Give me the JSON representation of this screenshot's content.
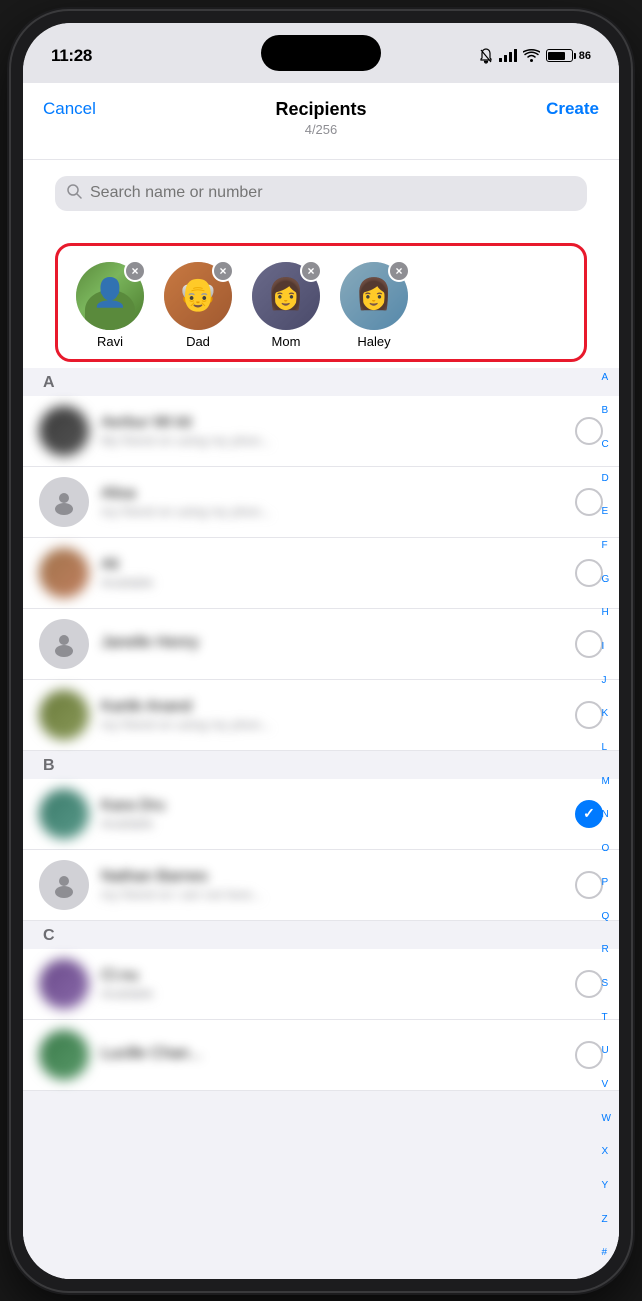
{
  "statusBar": {
    "time": "11:28",
    "battery": "86",
    "signal": "signal",
    "wifi": "wifi",
    "silent": true
  },
  "header": {
    "cancelLabel": "Cancel",
    "title": "Recipients",
    "subtitle": "4/256",
    "createLabel": "Create"
  },
  "search": {
    "placeholder": "Search name or number"
  },
  "selectedRecipients": [
    {
      "name": "Ravi",
      "avatarType": "ravi"
    },
    {
      "name": "Dad",
      "avatarType": "dad"
    },
    {
      "name": "Mom",
      "avatarType": "mom"
    },
    {
      "name": "Haley",
      "avatarType": "haley"
    }
  ],
  "alphaIndex": [
    "A",
    "B",
    "C",
    "D",
    "E",
    "F",
    "G",
    "H",
    "I",
    "J",
    "K",
    "L",
    "M",
    "N",
    "O",
    "P",
    "Q",
    "R",
    "S",
    "T",
    "U",
    "V",
    "W",
    "X",
    "Y",
    "Z",
    "#"
  ],
  "sections": [
    {
      "letter": "A",
      "contacts": [
        {
          "hasPhoto": true,
          "avatarClass": "av-dark",
          "nameBlur": "Aerbur Mt kit",
          "detailBlur": "My friend on using my phon...",
          "selected": false
        },
        {
          "hasPhoto": false,
          "nameBlur": "Alisa",
          "detailBlur": "my friend on using my phon...",
          "selected": false
        },
        {
          "hasPhoto": true,
          "avatarClass": "av-brown",
          "nameBlur": "Ali",
          "detailBlur": "Available",
          "selected": false
        },
        {
          "hasPhoto": false,
          "nameBlur": "Janelle Henry",
          "detailBlur": "",
          "selected": false
        },
        {
          "hasPhoto": true,
          "avatarClass": "av-olive",
          "nameBlur": "Kartik Anand",
          "detailBlur": "my friend on using my phon...",
          "selected": false
        }
      ]
    },
    {
      "letter": "B",
      "contacts": [
        {
          "hasPhoto": true,
          "avatarClass": "av-teal",
          "nameBlur": "Kara Dru",
          "detailBlur": "Available",
          "selected": true
        },
        {
          "hasPhoto": false,
          "nameBlur": "Nathan Barnes",
          "detailBlur": "my friend on i am not here...",
          "selected": false
        }
      ]
    },
    {
      "letter": "C",
      "contacts": [
        {
          "hasPhoto": true,
          "avatarClass": "av-purple",
          "nameBlur": "Cl.nu",
          "detailBlur": "Available",
          "selected": false
        },
        {
          "hasPhoto": true,
          "avatarClass": "av-green",
          "nameBlur": "Lucille Chan...",
          "detailBlur": "",
          "selected": false
        }
      ]
    }
  ]
}
